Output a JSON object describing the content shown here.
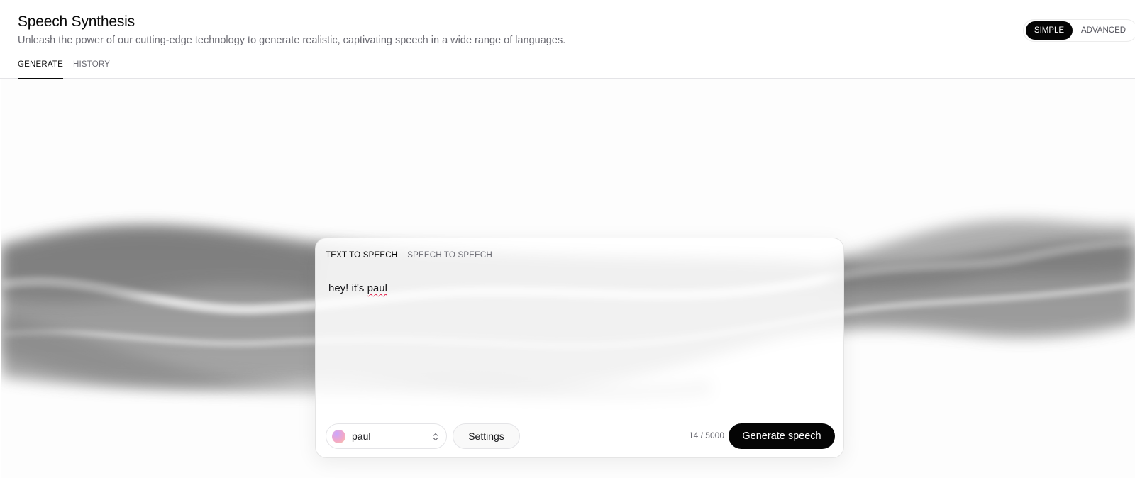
{
  "header": {
    "title": "Speech Synthesis",
    "subtitle": "Unleash the power of our cutting-edge technology to generate realistic, captivating speech in a wide range of languages.",
    "tabs": [
      {
        "label": "GENERATE",
        "active": true
      },
      {
        "label": "HISTORY",
        "active": false
      }
    ]
  },
  "mode_toggle": {
    "options": [
      {
        "label": "SIMPLE",
        "active": true
      },
      {
        "label": "ADVANCED",
        "active": false
      }
    ]
  },
  "card": {
    "tabs": [
      {
        "label": "TEXT TO SPEECH",
        "active": true
      },
      {
        "label": "SPEECH TO SPEECH",
        "active": false
      }
    ],
    "text_value": "hey! it's paul",
    "text_prefix": "hey! it's ",
    "text_misspelled": "paul",
    "voice": {
      "name": "paul",
      "icon": "voice-avatar",
      "dropdown_icon": "chevron-up-down-icon"
    },
    "settings_label": "Settings",
    "char_count": "14 / 5000",
    "generate_label": "Generate speech"
  },
  "colors": {
    "accent": "#050505",
    "muted_text": "#6b6b73",
    "border": "#e4e4e7",
    "background_wave": "#8c8c8c"
  }
}
